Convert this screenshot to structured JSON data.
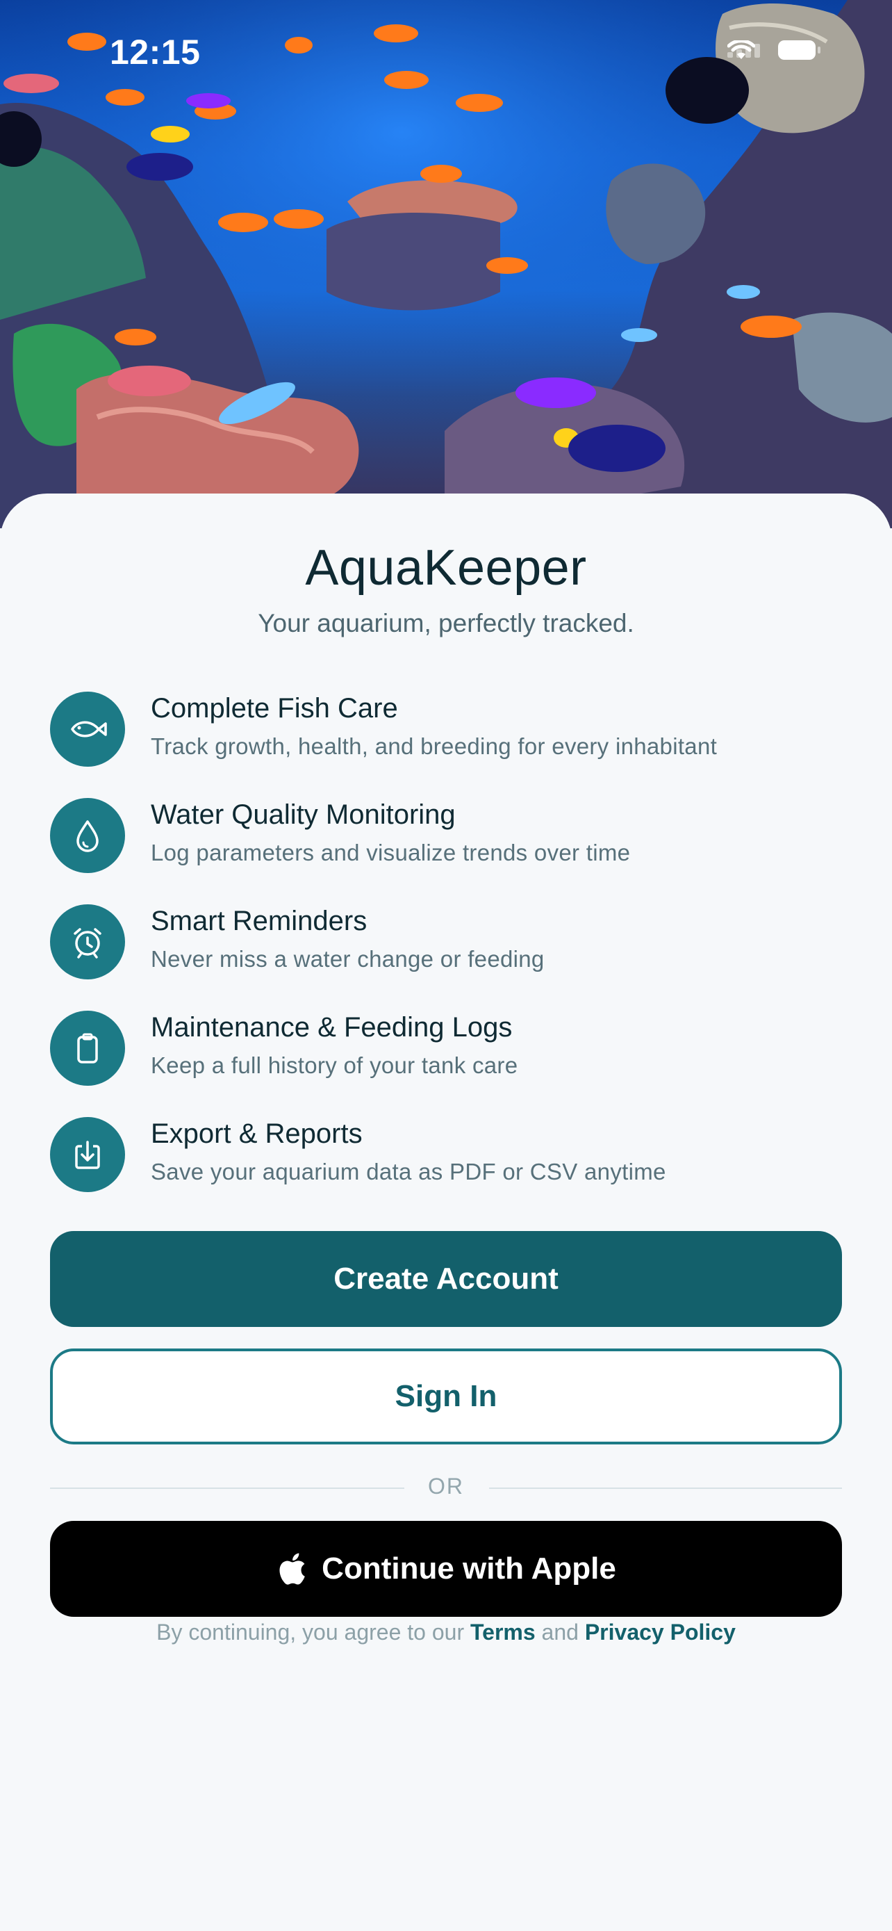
{
  "status_bar": {
    "time": "12:15"
  },
  "app": {
    "title": "AquaKeeper",
    "tagline": "Your aquarium, perfectly tracked."
  },
  "features": [
    {
      "icon": "fish-icon",
      "title": "Complete Fish Care",
      "description": "Track growth, health, and breeding for every inhabitant"
    },
    {
      "icon": "water-drop-icon",
      "title": "Water Quality Monitoring",
      "description": "Log parameters and visualize trends over time"
    },
    {
      "icon": "alarm-clock-icon",
      "title": "Smart Reminders",
      "description": "Never miss a water change or feeding"
    },
    {
      "icon": "clipboard-icon",
      "title": "Maintenance & Feeding Logs",
      "description": "Keep a full history of your tank care"
    },
    {
      "icon": "download-icon",
      "title": "Export & Reports",
      "description": "Save your aquarium data as PDF or CSV anytime"
    }
  ],
  "actions": {
    "create_account": "Create Account",
    "sign_in": "Sign In",
    "divider": "OR",
    "apple": "Continue with Apple"
  },
  "legal": {
    "prefix": "By continuing, you agree to our",
    "terms": "Terms",
    "and": "and",
    "privacy": "Privacy Policy"
  },
  "colors": {
    "accent": "#1c7a86",
    "primary_button": "#13606b",
    "background": "#f6f8fa",
    "title_text": "#0f2a33"
  }
}
